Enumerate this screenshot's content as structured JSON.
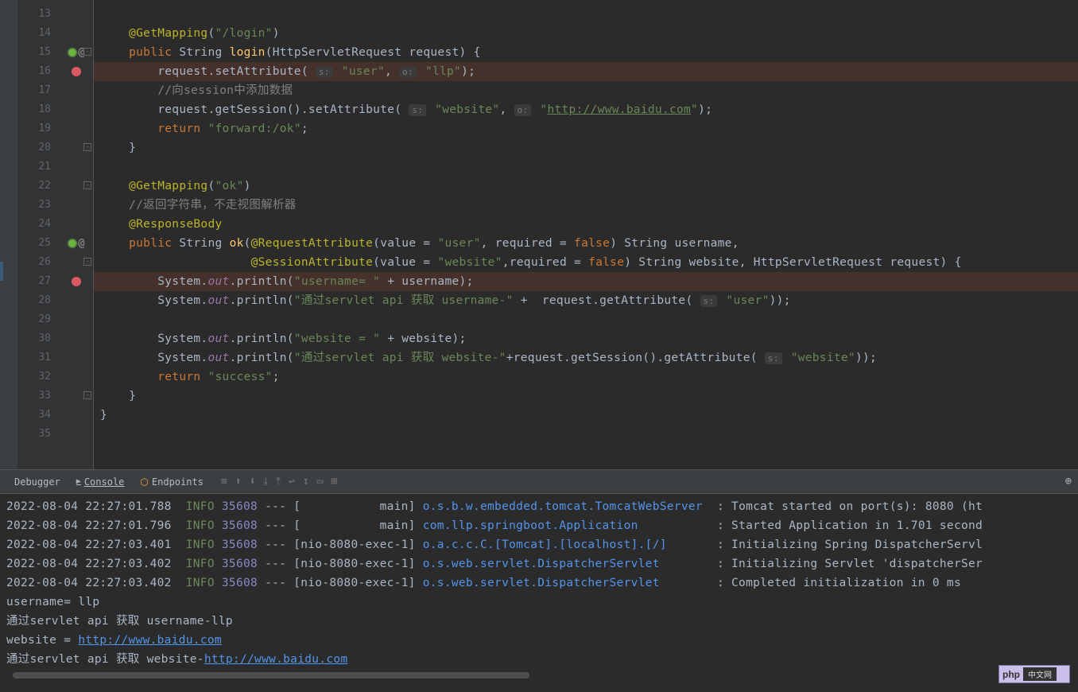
{
  "lines": {
    "start": 13,
    "end": 35
  },
  "code": {
    "l14": {
      "annotation": "@GetMapping",
      "arg": "\"/login\""
    },
    "l15": {
      "kw1": "public",
      "type": "String",
      "method": "login",
      "sig": "(HttpServletRequest request) {"
    },
    "l16": {
      "pre": "        request.setAttribute(",
      "hint1": "s:",
      "s1": "\"user\"",
      "comma": ",",
      "hint2": "o:",
      "s2": "\"llp\"",
      "end": ");"
    },
    "l17": {
      "comment": "        //向session中添加数据"
    },
    "l18": {
      "pre": "        request.getSession().setAttribute(",
      "hint1": "s:",
      "s1": "\"website\"",
      "comma": ",",
      "hint2": "o:",
      "url": "http://www.baidu.com",
      "end": ");"
    },
    "l19": {
      "kw": "return",
      "s": "\"forward:/ok\"",
      "end": ";"
    },
    "l20": {
      "brace": "    }"
    },
    "l22": {
      "annotation": "@GetMapping",
      "arg": "\"ok\""
    },
    "l23": {
      "comment": "    //返回字符串，不走视图解析器"
    },
    "l24": {
      "annotation": "@ResponseBody"
    },
    "l25": {
      "kw1": "public",
      "type": "String",
      "method": "ok",
      "attr": "@RequestAttribute",
      "v": "value",
      "vv": "\"user\"",
      "r": "required",
      "rf": "false",
      "tail": ") String username,"
    },
    "l26": {
      "attr": "@SessionAttribute",
      "v": "value",
      "vv": "\"website\"",
      "r": "required",
      "rf": "false",
      "tail": ") String website, HttpServletRequest request) {"
    },
    "l27": {
      "pre": "        System.",
      "field": "out",
      "call": ".println(",
      "s": "\"username= \"",
      "plus": " + username)",
      "end": ";"
    },
    "l28": {
      "pre": "        System.",
      "field": "out",
      "call": ".println(",
      "s": "\"通过servlet api 获取 username-\"",
      "plus": " +  request.getAttribute(",
      "hint": "s:",
      "s2": "\"user\"",
      "end": "));"
    },
    "l30": {
      "pre": "        System.",
      "field": "out",
      "call": ".println(",
      "s": "\"website = \"",
      "plus": " + website)",
      "end": ";"
    },
    "l31": {
      "pre": "        System.",
      "field": "out",
      "call": ".println(",
      "s": "\"通过servlet api 获取 website-\"",
      "plus": "+request.getSession().getAttribute(",
      "hint": "s:",
      "s2": "\"website\"",
      "end": "));"
    },
    "l32": {
      "kw": "return",
      "s": "\"success\"",
      "end": ";"
    },
    "l33": {
      "brace": "    }"
    },
    "l34": {
      "brace": "}"
    }
  },
  "tabs": {
    "debugger": "Debugger",
    "console": "Console",
    "endpoints": "Endpoints"
  },
  "console_lines": [
    {
      "ts": "2022-08-04 22:27:01.788",
      "lvl": "INFO",
      "pid": "35608",
      "thread": " --- [           main] ",
      "logger": "o.s.b.w.embedded.tomcat.TomcatWebServer",
      "msg": "  : Tomcat started on port(s): 8080 (ht"
    },
    {
      "ts": "2022-08-04 22:27:01.796",
      "lvl": "INFO",
      "pid": "35608",
      "thread": " --- [           main] ",
      "logger": "com.llp.springboot.Application",
      "msg": "           : Started Application in 1.701 second"
    },
    {
      "ts": "2022-08-04 22:27:03.401",
      "lvl": "INFO",
      "pid": "35608",
      "thread": " --- [nio-8080-exec-1] ",
      "logger": "o.a.c.c.C.[Tomcat].[localhost].[/]",
      "msg": "       : Initializing Spring DispatcherServl"
    },
    {
      "ts": "2022-08-04 22:27:03.402",
      "lvl": "INFO",
      "pid": "35608",
      "thread": " --- [nio-8080-exec-1] ",
      "logger": "o.s.web.servlet.DispatcherServlet",
      "msg": "        : Initializing Servlet 'dispatcherSer"
    },
    {
      "ts": "2022-08-04 22:27:03.402",
      "lvl": "INFO",
      "pid": "35608",
      "thread": " --- [nio-8080-exec-1] ",
      "logger": "o.s.web.servlet.DispatcherServlet",
      "msg": "        : Completed initialization in 0 ms"
    }
  ],
  "output": {
    "l1": "username= llp",
    "l2": "通过servlet api 获取 username-llp",
    "l3_pre": "website = ",
    "l3_url": "http://www.baidu.com",
    "l4_pre": "通过servlet api 获取 website-",
    "l4_url": "http://www.baidu.com"
  },
  "watermark": {
    "text": "php",
    "cn": "中文网"
  }
}
